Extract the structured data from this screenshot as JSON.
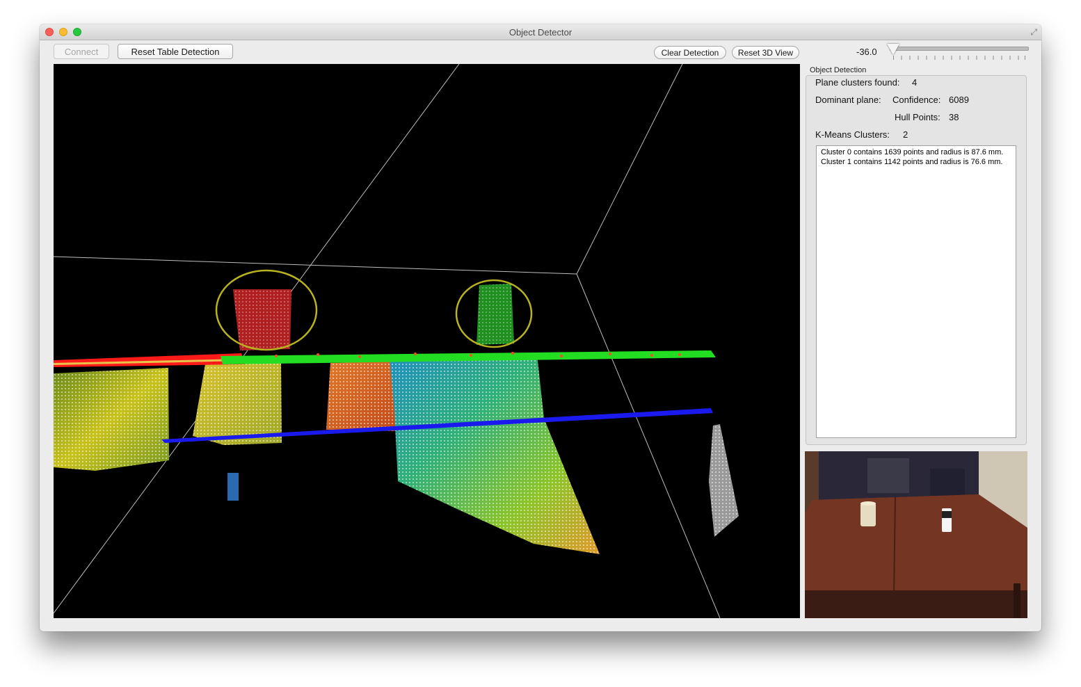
{
  "window": {
    "title": "Object Detector"
  },
  "toolbar": {
    "connect_label": "Connect",
    "reset_table_label": "Reset Table Detection",
    "clear_detection_label": "Clear Detection",
    "reset_3d_label": "Reset 3D View",
    "slider_value": "-36.0"
  },
  "panel": {
    "title": "Object Detection",
    "plane_clusters_label": "Plane clusters found:",
    "plane_clusters_value": "4",
    "dominant_plane_label": "Dominant plane:",
    "confidence_label": "Confidence:",
    "confidence_value": "6089",
    "hull_points_label": "Hull Points:",
    "hull_points_value": "38",
    "kmeans_label": "K-Means Clusters:",
    "kmeans_value": "2",
    "log": [
      "Cluster 0 contains 1639 points and radius is 87.6 mm.",
      "Cluster 1 contains 1142 points and radius is 76.6 mm."
    ]
  },
  "colors": {
    "plane_red": "#ff1a1a",
    "plane_green": "#22dd22",
    "plane_blue": "#1a1aee",
    "detection_ring": "#b9b320",
    "viewport_bg": "#000000"
  },
  "icons": [
    "close-icon",
    "minimize-icon",
    "zoom-icon",
    "fullscreen-icon"
  ]
}
